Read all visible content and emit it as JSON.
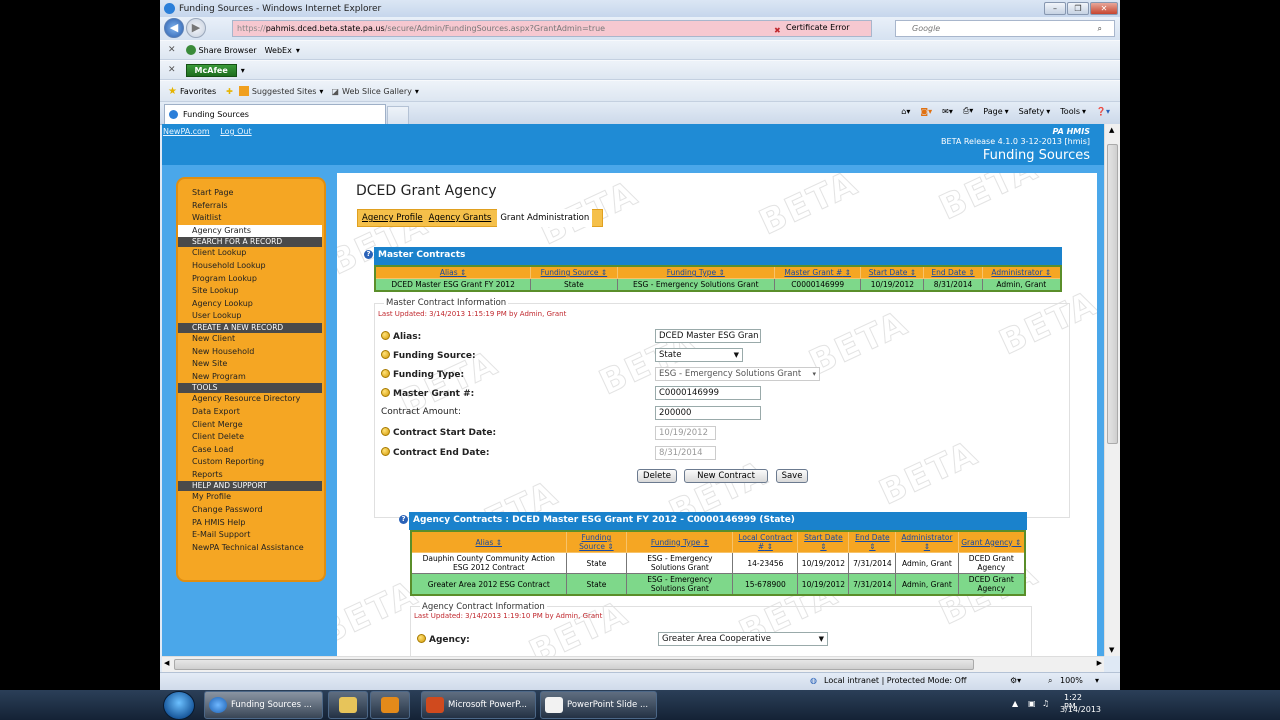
{
  "browser": {
    "window_title": "Funding Sources - Windows Internet Explorer",
    "url_prefix": "https://",
    "url_host": "pahmis.dced.beta.state.pa.us",
    "url_path": "/secure/Admin/FundingSources.aspx?GrantAdmin=true",
    "cert_error": "Certificate Error",
    "search_placeholder": "Google",
    "toolbar1": {
      "share_browser": "Share Browser",
      "webex": "WebEx"
    },
    "toolbar2": {
      "mcafee": "McAfee"
    },
    "favorites": {
      "label": "Favorites",
      "suggested": "Suggested Sites",
      "webslice": "Web Slice Gallery"
    },
    "tab_title": "Funding Sources",
    "commands": {
      "page": "Page",
      "safety": "Safety",
      "tools": "Tools"
    },
    "status": {
      "zone": "Local intranet | Protected Mode: Off",
      "zoom": "100%"
    }
  },
  "header": {
    "link_newpa": "NewPA.com",
    "link_logout": "Log Out",
    "app_name": "PA HMIS",
    "release": "BETA Release 4.1.0 3-12-2013 [hmis]",
    "page_title": "Funding Sources"
  },
  "sidebar": {
    "top": [
      "Start Page",
      "Referrals",
      "Waitlist",
      "Agency Grants"
    ],
    "sec_search": "SEARCH FOR A RECORD",
    "search": [
      "Client Lookup",
      "Household Lookup",
      "Program Lookup",
      "Site Lookup",
      "Agency Lookup",
      "User Lookup"
    ],
    "sec_create": "CREATE A NEW RECORD",
    "create": [
      "New Client",
      "New Household",
      "New Site",
      "New Program"
    ],
    "sec_tools": "TOOLS",
    "tools": [
      "Agency Resource Directory",
      "Data Export",
      "Client Merge",
      "Client Delete",
      "Case Load",
      "Custom Reporting",
      "Reports"
    ],
    "sec_help": "HELP AND SUPPORT",
    "help": [
      "My Profile",
      "Change Password",
      "PA HMIS Help",
      "E-Mail Support",
      "NewPA Technical Assistance"
    ]
  },
  "main": {
    "heading": "DCED Grant Agency",
    "tabs": [
      "Agency Profile",
      "Agency Grants",
      "Grant Administration"
    ],
    "watermark": "BETA",
    "master": {
      "title": "Master Contracts",
      "columns": [
        "Alias",
        "Funding Source",
        "Funding Type",
        "Master Grant #",
        "Start Date",
        "End Date",
        "Administrator"
      ],
      "rows": [
        [
          "DCED Master ESG Grant FY 2012",
          "State",
          "ESG - Emergency Solutions Grant",
          "C0000146999",
          "10/19/2012",
          "8/31/2014",
          "Admin, Grant"
        ]
      ],
      "info_title": "Master Contract Information",
      "last_updated": "Last Updated: 3/14/2013 1:15:19 PM by Admin, Grant",
      "fields": {
        "alias_label": "Alias:",
        "alias_value": "DCED Master ESG Gran",
        "source_label": "Funding Source:",
        "source_value": "State",
        "type_label": "Funding Type:",
        "type_value": "ESG - Emergency Solutions Grant",
        "grant_label": "Master Grant #:",
        "grant_value": "C0000146999",
        "amount_label": "Contract Amount:",
        "amount_value": "200000",
        "start_label": "Contract Start Date:",
        "start_value": "10/19/2012",
        "end_label": "Contract End Date:",
        "end_value": "8/31/2014"
      },
      "buttons": {
        "delete": "Delete",
        "new": "New Contract",
        "save": "Save"
      }
    },
    "agency": {
      "title": "Agency Contracts : DCED Master ESG Grant FY 2012 - C0000146999 (State)",
      "columns": [
        "Alias",
        "Funding Source",
        "Funding Type",
        "Local Contract #",
        "Start Date",
        "End Date",
        "Administrator",
        "Grant Agency"
      ],
      "rows": [
        [
          "Dauphin County Community Action ESG 2012 Contract",
          "State",
          "ESG - Emergency Solutions Grant",
          "14-23456",
          "10/19/2012",
          "7/31/2014",
          "Admin, Grant",
          "DCED Grant Agency"
        ],
        [
          "Greater Area 2012 ESG Contract",
          "State",
          "ESG - Emergency Solutions Grant",
          "15-678900",
          "10/19/2012",
          "7/31/2014",
          "Admin, Grant",
          "DCED Grant Agency"
        ]
      ],
      "info_title": "Agency Contract Information",
      "last_updated": "Last Updated: 3/14/2013 1:19:10 PM by Admin, Grant",
      "agency_label": "Agency:",
      "agency_value": "Greater Area Cooperative"
    }
  },
  "taskbar": {
    "items": [
      "Funding Sources ...",
      "Microsoft PowerP...",
      "PowerPoint Slide ..."
    ],
    "time": "1:22 PM",
    "date": "3/14/2013"
  },
  "colors": {
    "header_blue": "#1f8bd5",
    "sidebar_orange": "#f5a623",
    "row_green": "#7ed88a"
  }
}
